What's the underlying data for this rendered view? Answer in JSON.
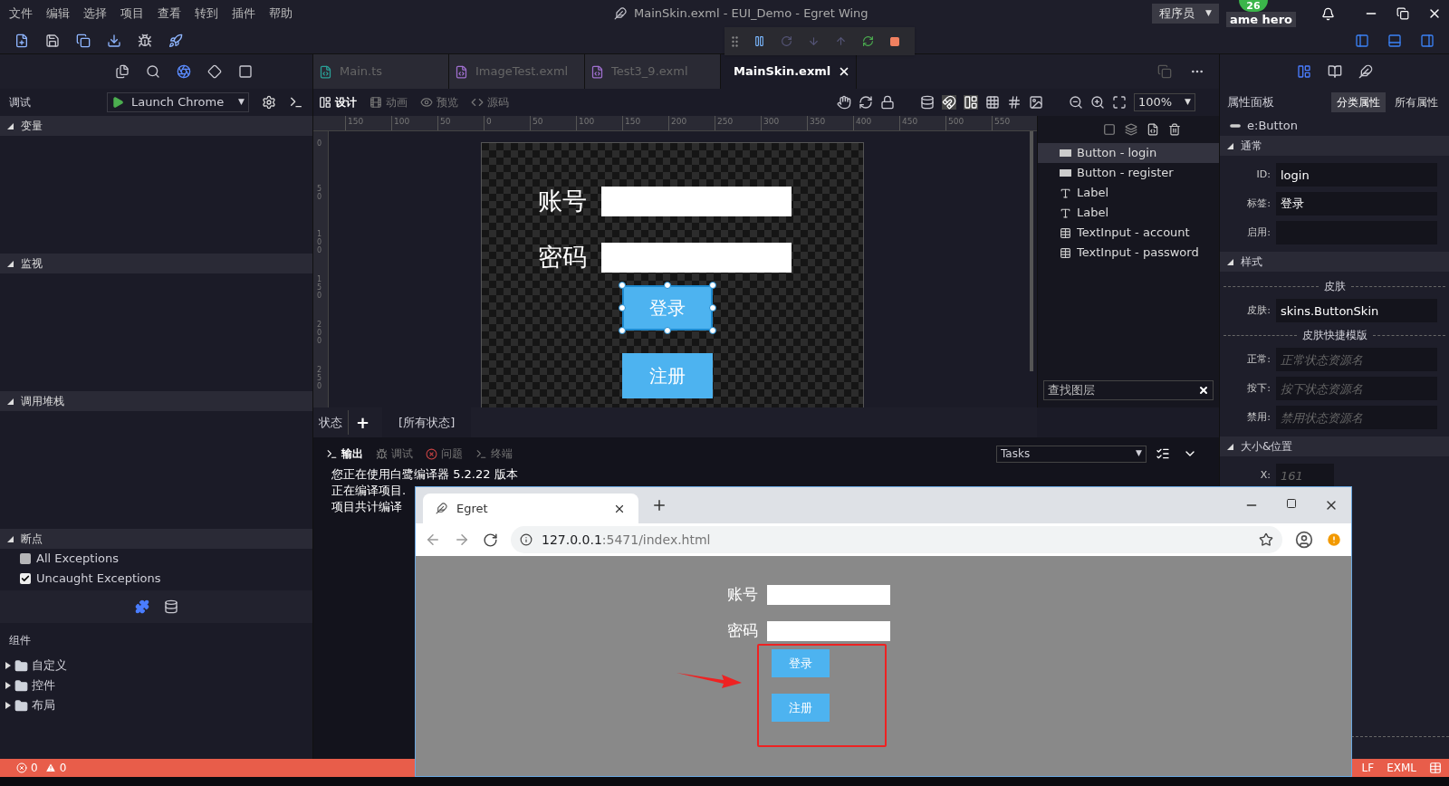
{
  "menu": [
    "文件",
    "编辑",
    "选择",
    "项目",
    "查看",
    "转到",
    "插件",
    "帮助"
  ],
  "window": {
    "title": "MainSkin.exml - EUI_Demo - Egret Wing"
  },
  "role": {
    "label": "程序员",
    "caret": "▼"
  },
  "user": {
    "name": "ame hero",
    "badge": "26"
  },
  "debug_panel": {
    "title": "调试",
    "launch": "Launch Chrome",
    "caret": "▼"
  },
  "sections": [
    {
      "label": "变量",
      "expanded": true
    },
    {
      "label": "监视",
      "expanded": true
    },
    {
      "label": "调用堆栈",
      "expanded": true
    },
    {
      "label": "断点",
      "expanded": true
    }
  ],
  "breakpoints": [
    {
      "label": "All Exceptions",
      "checked": false
    },
    {
      "label": "Uncaught Exceptions",
      "checked": true
    }
  ],
  "components": {
    "title": "组件",
    "items": [
      {
        "label": "自定义",
        "expanded": false
      },
      {
        "label": "控件",
        "expanded": false
      },
      {
        "label": "布局",
        "expanded": false
      }
    ]
  },
  "editor_tabs": [
    {
      "label": "Main.ts",
      "kind": "ts",
      "selected": false
    },
    {
      "label": "ImageTest.exml",
      "kind": "exml",
      "selected": false
    },
    {
      "label": "Test3_9.exml",
      "kind": "exml",
      "selected": false
    },
    {
      "label": "MainSkin.exml",
      "kind": "exml",
      "selected": true
    }
  ],
  "view_modes": [
    {
      "label": "设计",
      "kind": "design",
      "selected": true
    },
    {
      "label": "动画",
      "kind": "anim",
      "selected": false
    },
    {
      "label": "预览",
      "kind": "preview",
      "selected": false
    },
    {
      "label": "源码",
      "kind": "code",
      "selected": false
    }
  ],
  "zoom": {
    "value": "100%",
    "caret": "▼"
  },
  "ruler_h": [
    "150",
    "100",
    "50",
    "0",
    "50",
    "100",
    "150",
    "200",
    "250",
    "300",
    "350",
    "400",
    "450",
    "500",
    "550"
  ],
  "ruler_v": [
    "0",
    "50",
    "100",
    "150",
    "200",
    "250"
  ],
  "canvas": {
    "fields": [
      {
        "label": "账号"
      },
      {
        "label": "密码"
      }
    ],
    "buttons": [
      {
        "label": "登录",
        "selected": true
      },
      {
        "label": "注册",
        "selected": false
      }
    ]
  },
  "layers": {
    "items": [
      {
        "label": "Button - login",
        "kind": "button",
        "selected": true
      },
      {
        "label": "Button - register",
        "kind": "button",
        "selected": false
      },
      {
        "label": "Label",
        "kind": "label",
        "selected": false
      },
      {
        "label": "Label",
        "kind": "label",
        "selected": false
      },
      {
        "label": "TextInput - account",
        "kind": "input",
        "selected": false
      },
      {
        "label": "TextInput - password",
        "kind": "input",
        "selected": false
      }
    ],
    "search_placeholder": "查找图层"
  },
  "states": {
    "label": "状态",
    "add": "+",
    "current": "[所有状态]"
  },
  "output_tabs": [
    {
      "label": "输出",
      "kind": "output",
      "selected": true
    },
    {
      "label": "调试",
      "kind": "debug",
      "selected": false
    },
    {
      "label": "问题",
      "kind": "problems",
      "selected": false
    },
    {
      "label": "终端",
      "kind": "terminal",
      "selected": false
    }
  ],
  "tasks": {
    "value": "Tasks",
    "caret": "▼"
  },
  "output_lines": [
    "您正在使用白鹭编译器 5.2.22 版本",
    "正在编译项目.",
    "项目共计编译"
  ],
  "properties": {
    "title": "属性面板",
    "tabs": [
      {
        "label": "分类属性",
        "selected": true
      },
      {
        "label": "所有属性",
        "selected": false
      }
    ],
    "component": "e:Button",
    "groups": [
      {
        "label": "通常",
        "rows": [
          {
            "kind": "field",
            "label": "ID:",
            "value": "login"
          },
          {
            "kind": "field",
            "label": "标签:",
            "value": "登录"
          },
          {
            "kind": "field",
            "label": "启用:"
          }
        ]
      },
      {
        "label": "样式",
        "rows": [
          {
            "kind": "divider",
            "label": "皮肤"
          },
          {
            "kind": "field",
            "label": "皮肤:",
            "value": "skins.ButtonSkin"
          },
          {
            "kind": "divider",
            "label": "皮肤快捷模版"
          },
          {
            "kind": "field",
            "label": "正常:",
            "placeholder": "正常状态资源名"
          },
          {
            "kind": "field",
            "label": "按下:",
            "placeholder": "按下状态资源名"
          },
          {
            "kind": "field",
            "label": "禁用:",
            "placeholder": "禁用状态资源名"
          }
        ]
      },
      {
        "label": "大小&位置",
        "rows": [
          {
            "kind": "short",
            "label": "X:",
            "placeholder": "161"
          }
        ]
      }
    ]
  },
  "browser": {
    "tab": "Egret",
    "url_host": "127.0.0.1",
    "url_rest": ":5471/index.html",
    "fields": [
      {
        "label": "账号"
      },
      {
        "label": "密码"
      }
    ],
    "buttons": [
      "登录",
      "注册"
    ]
  },
  "status": {
    "errors": "0",
    "warnings": "0",
    "eol": "LF",
    "lang": "EXML"
  }
}
